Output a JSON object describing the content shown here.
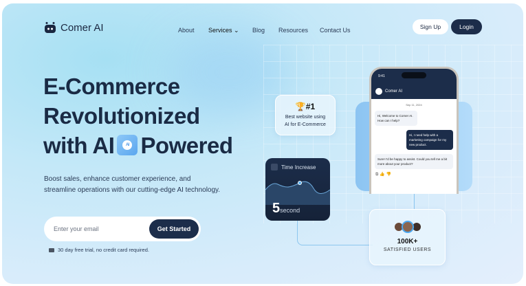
{
  "nav": {
    "brand": "Comer AI",
    "links": [
      "About",
      "Services",
      "Blog",
      "Resources",
      "Contact Us"
    ],
    "signup": "Sign Up",
    "login": "Login"
  },
  "hero": {
    "line1": "E-Commerce",
    "line2": "Revolutionized",
    "line3a": "with AI",
    "line3b": "Powered",
    "paragraph": "Boost sales, enhance customer experience, and streamline operations with our cutting-edge AI technology.",
    "email_placeholder": "Enter your email",
    "cta": "Get Started",
    "note": "30 day free trial, no credit card required."
  },
  "badge": {
    "rank": "#1",
    "text": "Best website using AI for E-Commerce"
  },
  "time": {
    "title": "Time Increase",
    "value": "5",
    "unit": "second"
  },
  "users": {
    "count": "100K+",
    "label": "SATISFIED USERS"
  },
  "phone": {
    "time": "9:41",
    "app": "Comer AI",
    "date": "Sep 11, 2024",
    "messages": [
      {
        "from": "bot",
        "text": "Hi, Welcome to Comer AI. How can I help?"
      },
      {
        "from": "user",
        "text": "Hi, I need help with a marketing campaign for my new product."
      },
      {
        "from": "bot",
        "text": "Sure! I'd be happy to assist. Could you tell me a bit more about your product?"
      }
    ]
  },
  "colors": {
    "navy": "#1c2d4a",
    "accent": "#5aa6ef"
  }
}
